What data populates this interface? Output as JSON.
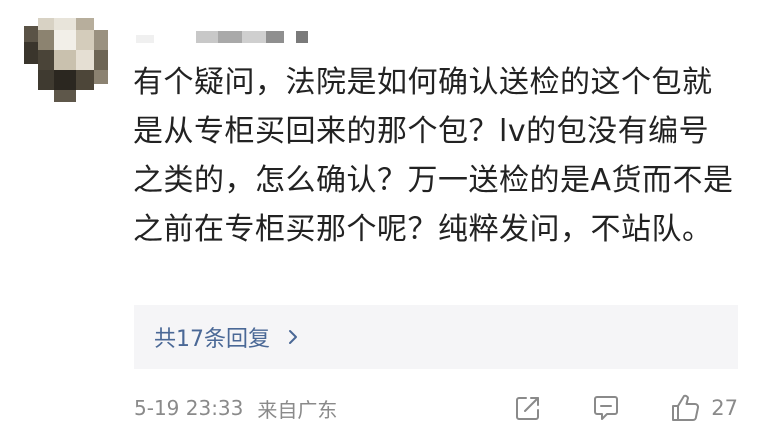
{
  "comment": {
    "author_name": "",
    "text": "有个疑问，法院是如何确认送检的这个包就是从专柜买回来的那个包？lv的包没有编号之类的，怎么确认？万一送检的是A货而不是之前在专柜买那个呢？纯粹发问，不站队。",
    "replies_label": "共17条回复",
    "timestamp": "5-19 23:33",
    "location": "来自广东",
    "like_count": "27"
  },
  "icons": {
    "replies_chevron": "chevron-right-icon",
    "share": "share-icon",
    "comment": "comment-icon",
    "like": "thumbs-up-icon"
  },
  "colors": {
    "link": "#4a6896",
    "meta": "#8a8a8a",
    "text": "#222222",
    "reply_bg": "#f5f5f7"
  }
}
